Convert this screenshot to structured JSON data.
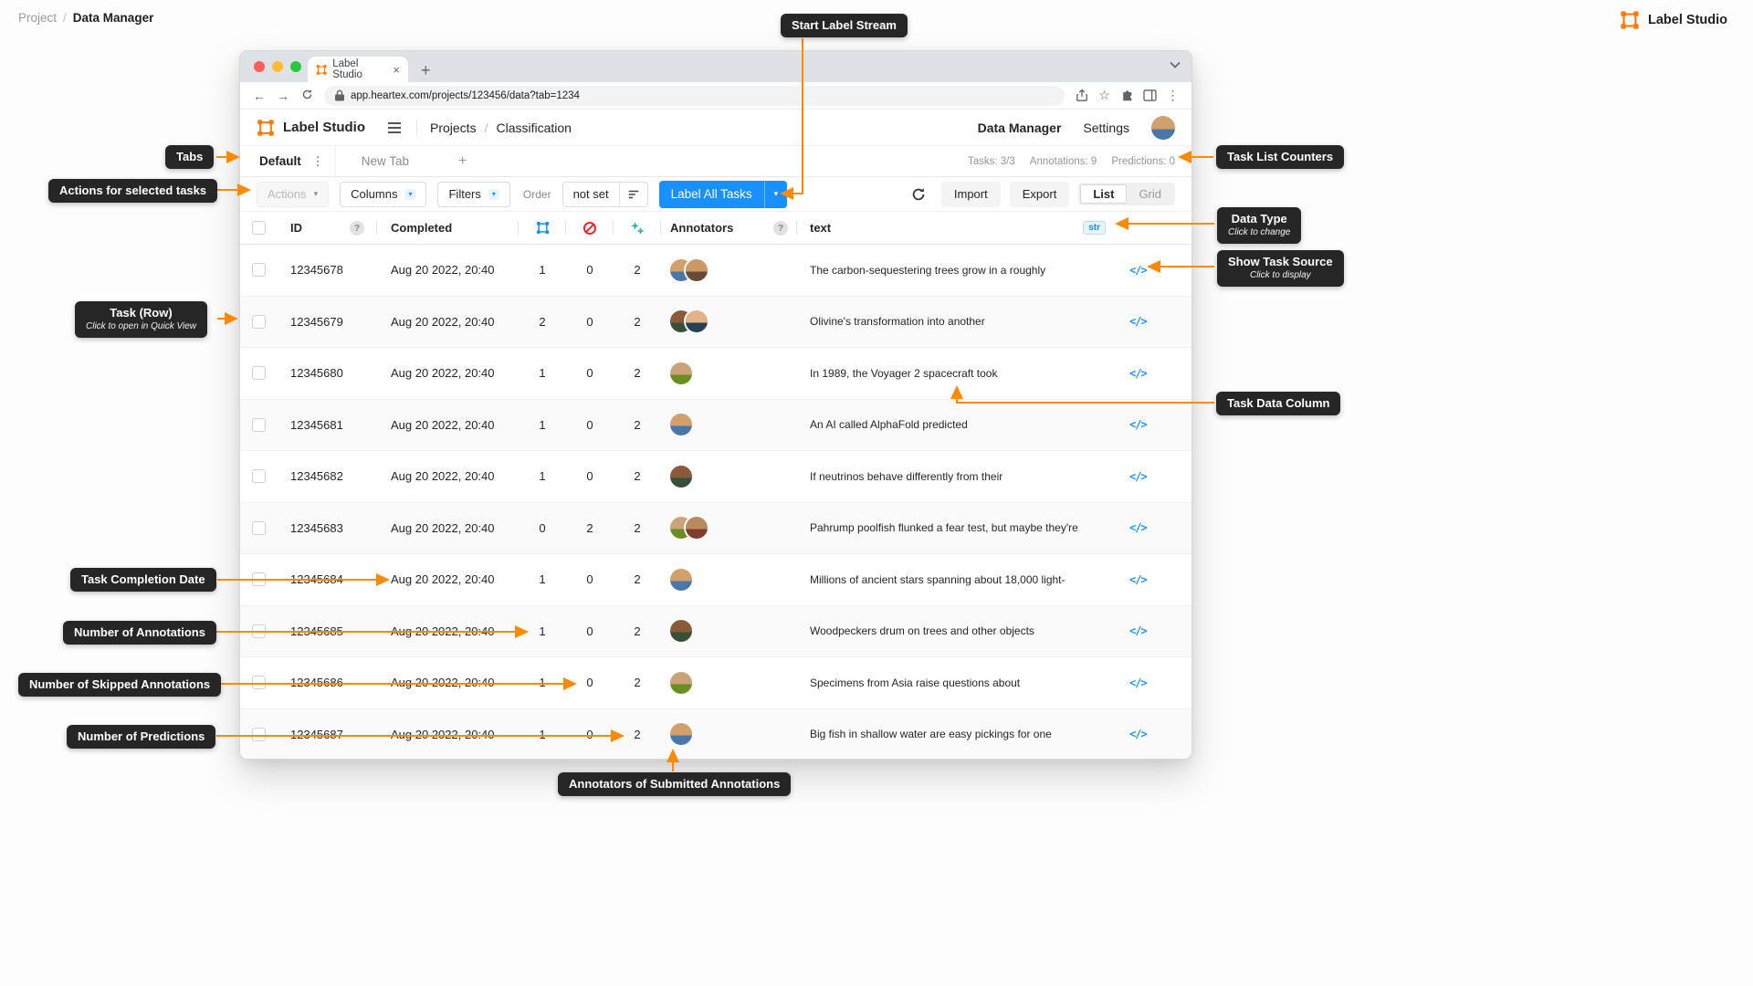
{
  "colors": {
    "accent": "#ff8a00",
    "brand": "#ff7b07",
    "primary": "#1890ff",
    "danger": "#f5222d",
    "prediction": "#2db7a3",
    "callout": "#262626"
  },
  "page": {
    "breadcrumb": {
      "root": "Project",
      "sep": "/",
      "current": "Data Manager"
    },
    "brand": "Label Studio"
  },
  "browser": {
    "tab": "Label Studio",
    "url": "app.heartex.com/projects/123456/data?tab=1234"
  },
  "header": {
    "brand": "Label Studio",
    "project_nav": "Projects",
    "nav_sep": "/",
    "project_name": "Classification",
    "data_manager": "Data Manager",
    "settings": "Settings"
  },
  "tabs": {
    "active": "Default",
    "new_tab": "New Tab",
    "add": "+",
    "counters": {
      "tasks": "Tasks: 3/3",
      "annotations": "Annotations: 9",
      "predictions": "Predictions: 0"
    }
  },
  "toolbar": {
    "actions": "Actions",
    "columns": "Columns",
    "filters": "Filters",
    "order_label": "Order",
    "order_value": "not set",
    "label_all_tasks": "Label All Tasks",
    "import": "Import",
    "export": "Export",
    "view_list": "List",
    "view_grid": "Grid"
  },
  "table": {
    "headers": {
      "id": "ID",
      "completed": "Completed",
      "annotators": "Annotators",
      "text": "text"
    },
    "type_badge": "str",
    "source_icon": "</>",
    "rows": [
      {
        "id": "12345678",
        "completed": "Aug 20 2022, 20:40",
        "annotations": "1",
        "skipped": "0",
        "predictions": "2",
        "annotators": 2,
        "text": "The carbon-sequestering trees grow in a roughly"
      },
      {
        "id": "12345679",
        "completed": "Aug 20 2022, 20:40",
        "annotations": "2",
        "skipped": "0",
        "predictions": "2",
        "annotators": 2,
        "text": "Olivine's transformation into another"
      },
      {
        "id": "12345680",
        "completed": "Aug 20 2022, 20:40",
        "annotations": "1",
        "skipped": "0",
        "predictions": "2",
        "annotators": 1,
        "text": "In 1989, the Voyager 2 spacecraft took"
      },
      {
        "id": "12345681",
        "completed": "Aug 20 2022, 20:40",
        "annotations": "1",
        "skipped": "0",
        "predictions": "2",
        "annotators": 1,
        "text": "An AI called AlphaFold predicted"
      },
      {
        "id": "12345682",
        "completed": "Aug 20 2022, 20:40",
        "annotations": "1",
        "skipped": "0",
        "predictions": "2",
        "annotators": 1,
        "text": "If neutrinos behave differently from their"
      },
      {
        "id": "12345683",
        "completed": "Aug 20 2022, 20:40",
        "annotations": "0",
        "skipped": "2",
        "predictions": "2",
        "annotators": 2,
        "text": "Pahrump poolfish flunked a fear test, but maybe they're"
      },
      {
        "id": "12345684",
        "completed": "Aug 20 2022, 20:40",
        "annotations": "1",
        "skipped": "0",
        "predictions": "2",
        "annotators": 1,
        "text": "Millions of ancient stars spanning about 18,000 light-"
      },
      {
        "id": "12345685",
        "completed": "Aug 20 2022, 20:40",
        "annotations": "1",
        "skipped": "0",
        "predictions": "2",
        "annotators": 1,
        "text": "Woodpeckers drum on trees and other objects"
      },
      {
        "id": "12345686",
        "completed": "Aug 20 2022, 20:40",
        "annotations": "1",
        "skipped": "0",
        "predictions": "2",
        "annotators": 1,
        "text": "Specimens from Asia raise questions about"
      },
      {
        "id": "12345687",
        "completed": "Aug 20 2022, 20:40",
        "annotations": "1",
        "skipped": "0",
        "predictions": "2",
        "annotators": 1,
        "text": "Big fish in shallow water are easy pickings for one"
      }
    ]
  },
  "callouts": {
    "start_label_stream": "Start Label Stream",
    "tabs": "Tabs",
    "actions_for_selected": "Actions for selected tasks",
    "task_list_counters": "Task List Counters",
    "data_type": {
      "title": "Data Type",
      "sub": "Click to change"
    },
    "show_task_source": {
      "title": "Show Task Source",
      "sub": "Click to display"
    },
    "task_row": {
      "title": "Task (Row)",
      "sub": "Click to open in Quick View"
    },
    "task_data_column": "Task Data Column",
    "task_completion_date": "Task Completion Date",
    "number_of_annotations": "Number of Annotations",
    "number_of_skipped_annotations": "Number of Skipped Annotations",
    "number_of_predictions": "Number of Predictions",
    "annotators_of_submitted": "Annotators of Submitted Annotations"
  }
}
